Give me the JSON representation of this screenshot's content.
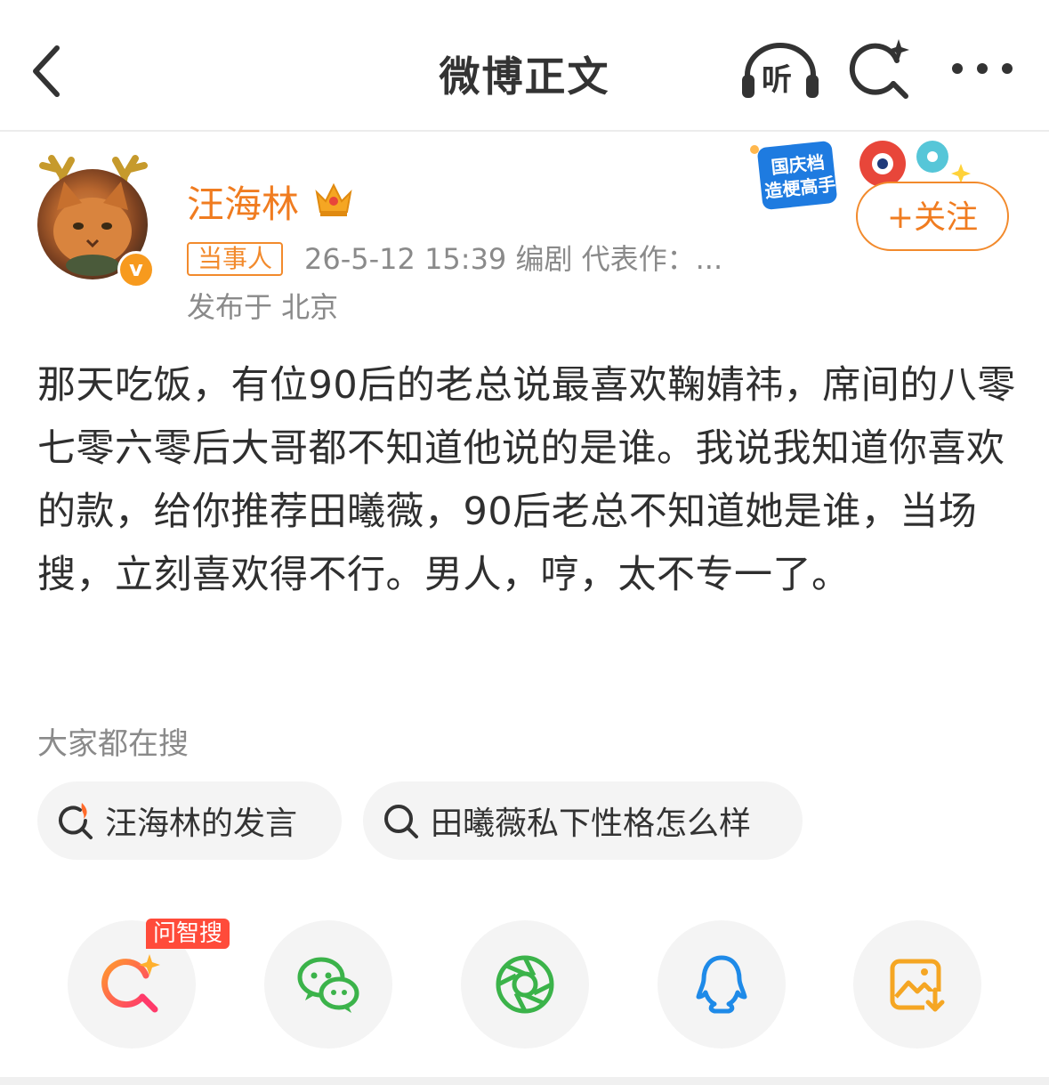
{
  "header": {
    "title": "微博正文",
    "listen_label": "听"
  },
  "post": {
    "author": "汪海林",
    "role_tag": "当事人",
    "meta": "26-5-12 15:39  编剧  代表作：...",
    "location": "发布于 北京",
    "follow_label": "+关注",
    "promo_text": "国庆档 造梗高手",
    "content": "那天吃饭，有位90后的老总说最喜欢鞠婧祎，席间的八零七零六零后大哥都不知道他说的是谁。我说我知道你喜欢的款，给你推荐田曦薇，90后老总不知道她是谁，当场搜，立刻喜欢得不行。男人，哼，太不专一了。"
  },
  "hot_search": {
    "title": "大家都在搜",
    "chips": [
      {
        "label": "汪海林的发言",
        "icon": "hot-search-icon"
      },
      {
        "label": "田曦薇私下性格怎么样",
        "icon": "search-icon"
      }
    ]
  },
  "share_bar": {
    "badge": "问智搜",
    "buttons": [
      "ai-search-icon",
      "wechat-icon",
      "moments-icon",
      "qq-icon",
      "save-image-icon"
    ]
  },
  "colors": {
    "accent": "#f07c20",
    "badge_red": "#ff4b3a"
  }
}
